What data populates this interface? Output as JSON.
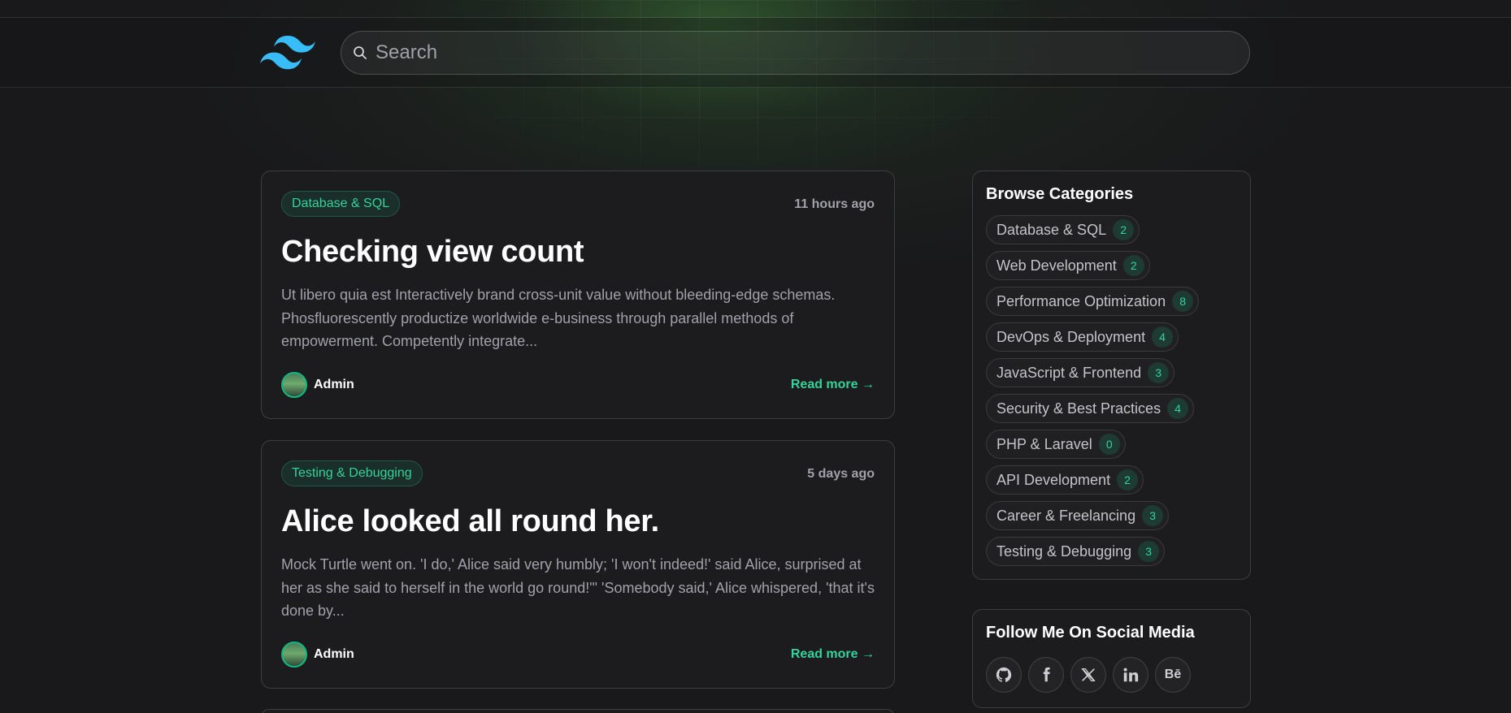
{
  "header": {
    "logo_icon": "tailwind-waves-icon",
    "search_placeholder": "Search"
  },
  "posts": [
    {
      "category": "Database & SQL",
      "time": "11 hours ago",
      "title": "Checking view count",
      "excerpt": "Ut libero quia est Interactively brand cross-unit value without bleeding-edge schemas. Phosfluorescently productize worldwide e-business through parallel methods of empowerment. Competently integrate...",
      "author": "Admin",
      "read_more": "Read more →"
    },
    {
      "category": "Testing & Debugging",
      "time": "5 days ago",
      "title": "Alice looked all round her.",
      "excerpt": "Mock Turtle went on. 'I do,' Alice said very humbly; 'I won't indeed!' said Alice, surprised at her as she said to herself in the world go round!\"' 'Somebody said,' Alice whispered, 'that it's done by...",
      "author": "Admin",
      "read_more": "Read more →"
    }
  ],
  "sidebar": {
    "categories_title": "Browse Categories",
    "categories": [
      {
        "label": "Database & SQL",
        "count": "2"
      },
      {
        "label": "Web Development",
        "count": "2"
      },
      {
        "label": "Performance Optimization",
        "count": "8"
      },
      {
        "label": "DevOps & Deployment",
        "count": "4"
      },
      {
        "label": "JavaScript & Frontend",
        "count": "3"
      },
      {
        "label": "Security & Best Practices",
        "count": "4"
      },
      {
        "label": "PHP & Laravel",
        "count": "0"
      },
      {
        "label": "API Development",
        "count": "2"
      },
      {
        "label": "Career & Freelancing",
        "count": "3"
      },
      {
        "label": "Testing & Debugging",
        "count": "3"
      }
    ],
    "social_title": "Follow Me On Social Media",
    "social_icons": [
      "github-icon",
      "facebook-icon",
      "x-icon",
      "linkedin-icon",
      "behance-icon"
    ],
    "behance_label": "Bē"
  },
  "colors": {
    "accent": "#34d399",
    "background": "#19191b",
    "card": "#1c1c1e"
  }
}
